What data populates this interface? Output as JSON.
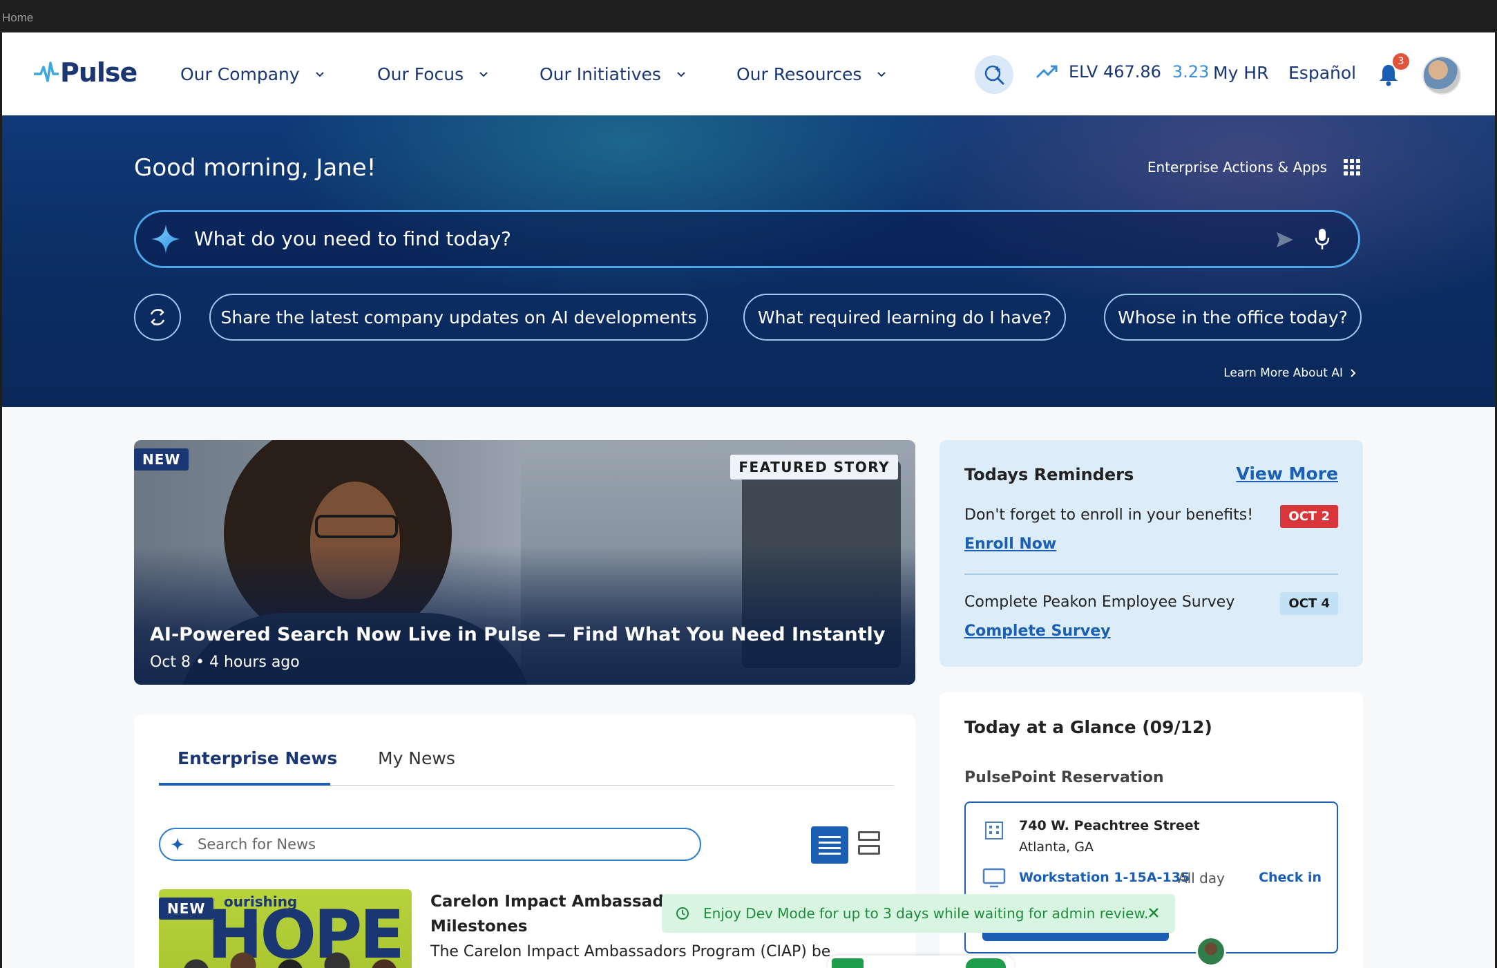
{
  "frame": {
    "title": "Home"
  },
  "header": {
    "logo": "Pulse",
    "nav": [
      {
        "label": "Our Company"
      },
      {
        "label": "Our Focus"
      },
      {
        "label": "Our Initiatives"
      },
      {
        "label": "Our Resources"
      }
    ],
    "stock": {
      "ticker": "ELV 467.86",
      "change": "3.23"
    },
    "my_hr": "My HR",
    "language": "Español",
    "notification_count": "3"
  },
  "hero": {
    "greeting": "Good morning, Jane!",
    "enterprise_actions": "Enterprise Actions & Apps",
    "search_placeholder": "What do you need to find today?",
    "chips": [
      "Share the latest company updates on AI developments",
      "What required learning do I have?",
      "Whose in the office today?"
    ],
    "learn_more": "Learn More About AI"
  },
  "featured": {
    "badge_new": "NEW",
    "badge_featured": "FEATURED STORY",
    "title": "AI-Powered Search Now Live in Pulse — Find What You Need Instantly",
    "meta": "Oct 8 • 4 hours ago"
  },
  "news": {
    "tabs": [
      "Enterprise News",
      "My News"
    ],
    "search_placeholder": "Search for News",
    "item": {
      "badge": "NEW",
      "thumb_text": "ourishing",
      "thumb_big": "HOPE",
      "title": "Carelon Impact Ambassadors P",
      "title_line2": "Milestones",
      "desc": "The Carelon Impact Ambassadors Program (CIAP) be"
    }
  },
  "reminders": {
    "title": "Todays Reminders",
    "view_more": "View More",
    "items": [
      {
        "text": "Don't forget to enroll in your benefits!",
        "link": "Enroll Now",
        "date": "OCT 2"
      },
      {
        "text": "Complete Peakon Employee Survey",
        "link": "Complete Survey",
        "date": "OCT 4"
      }
    ]
  },
  "glance": {
    "title": "Today at a Glance (09/12)",
    "subtitle": "PulsePoint Reservation",
    "street": "740 W. Peachtree Street",
    "city": "Atlanta, GA",
    "workstation": "Workstation 1-15A-135",
    "time": "All day",
    "check_in": "Check in"
  },
  "toast": {
    "message": "Enjoy Dev Mode for up to 3 days while waiting for admin review."
  },
  "colors": {
    "brand": "#1a3673",
    "accent": "#1a5fb4",
    "hero_bg": "#0b2d63",
    "alert_red": "#d8363a",
    "toast_green": "#1e8a3c"
  }
}
